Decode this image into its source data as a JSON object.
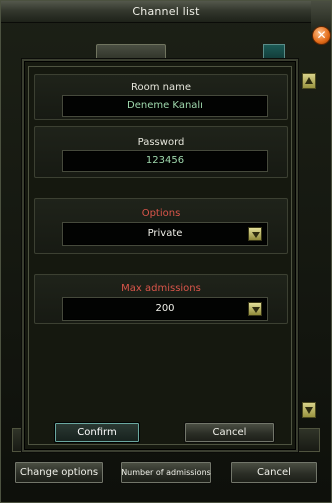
{
  "window": {
    "title": "Channel list"
  },
  "dialog": {
    "room_name_label": "Room name",
    "room_name_value": "Deneme Kanalı",
    "password_label": "Password",
    "password_value": "123456",
    "options_label": "Options",
    "options_value": "Private",
    "max_admissions_label": "Max admissions",
    "max_admissions_value": "200",
    "confirm_label": "Confirm",
    "cancel_label": "Cancel"
  },
  "bottom_bar": {
    "change_options_label": "Change options",
    "number_of_admissions_label": "Number of admissions",
    "cancel_label": "Cancel"
  },
  "colors": {
    "field_text": "#9fd8ad",
    "section_label_accent": "#d9554a",
    "close_button": "#e36b18",
    "dropdown_arrow": "#d8d28a"
  },
  "icons": {
    "close": "close-icon",
    "dropdown": "chevron-down-icon",
    "scroll_up": "arrow-up-icon",
    "scroll_down": "arrow-down-icon"
  }
}
